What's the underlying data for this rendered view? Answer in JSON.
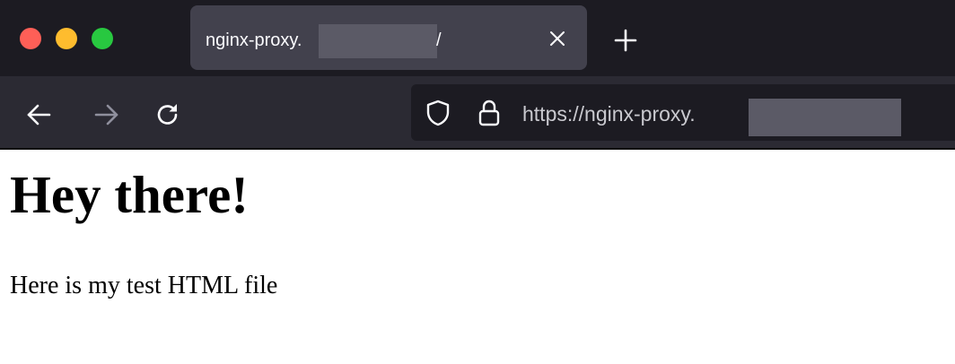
{
  "window": {
    "traffic_lights": {
      "close_color": "#fe5f57",
      "minimize_color": "#febc2e",
      "maximize_color": "#28c840"
    }
  },
  "tab": {
    "title_prefix": "nginx-proxy.",
    "title_suffix": "/",
    "close_icon": "close-icon",
    "redacted": true
  },
  "toolbar": {
    "new_tab_icon": "plus-icon",
    "back_icon": "arrow-left-icon",
    "forward_icon": "arrow-right-icon",
    "reload_icon": "reload-icon"
  },
  "urlbar": {
    "shield_icon": "shield-icon",
    "lock_icon": "lock-icon",
    "url_prefix": "https://nginx-proxy.",
    "redacted": true
  },
  "page": {
    "heading": "Hey there!",
    "paragraph": "Here is my test HTML file"
  },
  "colors": {
    "tabbar_bg": "#1c1b22",
    "active_tab_bg": "#42414d",
    "toolbar_bg": "#2b2a33",
    "urlbar_bg": "#1c1b22",
    "redaction": "#5b5a66",
    "page_bg": "#ffffff"
  }
}
